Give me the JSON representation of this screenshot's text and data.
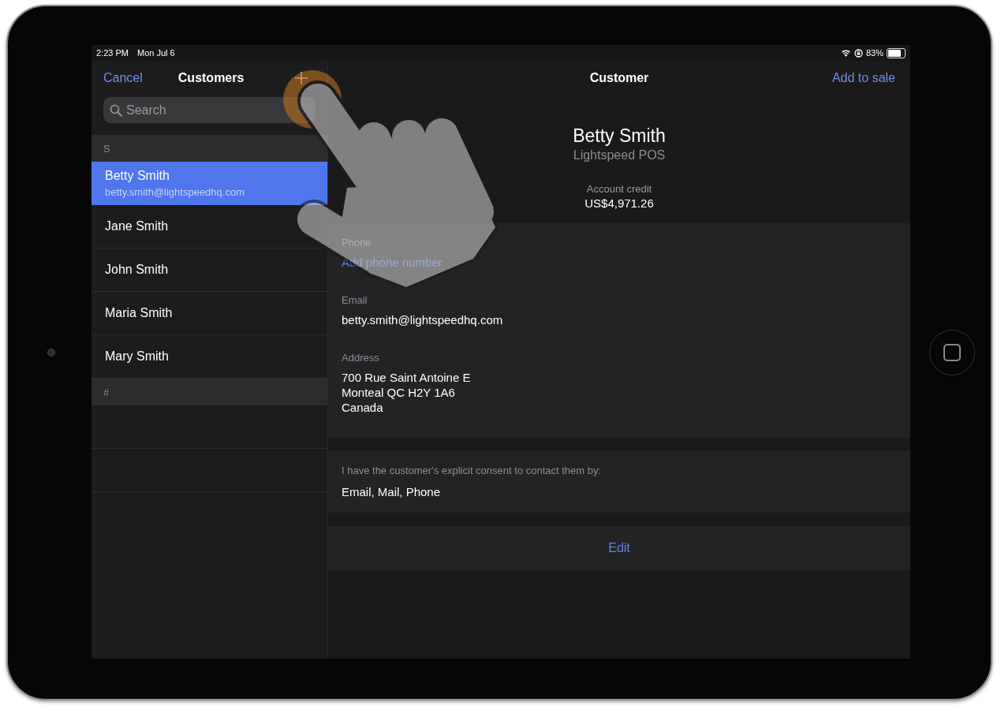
{
  "status_bar": {
    "time": "2:23 PM",
    "date": "Mon Jul 6",
    "battery": "83%"
  },
  "sidebar": {
    "cancel": "Cancel",
    "title": "Customers",
    "search": {
      "placeholder": "Search"
    },
    "sections": [
      {
        "letter": "S",
        "customers": [
          {
            "name": "Betty Smith",
            "email": "betty.smith@lightspeedhq.com",
            "selected": true
          },
          {
            "name": "Jane Smith",
            "selected": false
          },
          {
            "name": "John Smith",
            "selected": false
          },
          {
            "name": "Maria Smith",
            "selected": false
          },
          {
            "name": "Mary Smith",
            "selected": false
          }
        ]
      },
      {
        "letter": "#"
      }
    ]
  },
  "detail": {
    "title": "Customer",
    "action": "Add to sale",
    "name": "Betty Smith",
    "company": "Lightspeed POS",
    "credit_label": "Account credit",
    "credit": "US$4,971.26",
    "fields": [
      {
        "label": "Phone",
        "kind": "link",
        "lines": [
          "Add phone number"
        ]
      },
      {
        "label": "Email",
        "kind": "text",
        "lines": [
          "betty.smith@lightspeedhq.com"
        ]
      },
      {
        "label": "Address",
        "kind": "text",
        "lines": [
          "700 Rue Saint Antoine E",
          "Monteal QC H2Y 1A6",
          "Canada"
        ]
      }
    ],
    "consent": {
      "label": "I have the customer's explicit consent to contact them by:",
      "value": "Email, Mail, Phone"
    },
    "edit": "Edit"
  }
}
